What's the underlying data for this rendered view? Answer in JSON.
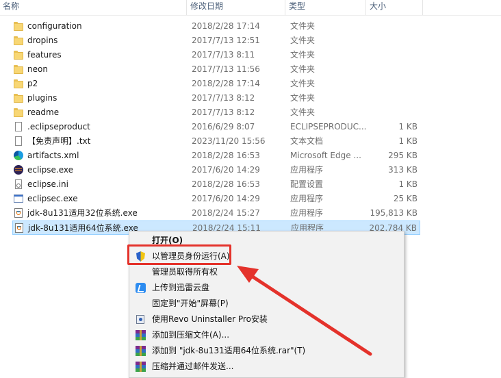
{
  "columns": {
    "name": "名称",
    "date": "修改日期",
    "type": "类型",
    "size": "大小"
  },
  "files": [
    {
      "name": "configuration",
      "date": "2018/2/28 17:14",
      "type": "文件夹",
      "size": "",
      "icon": "folder-icon"
    },
    {
      "name": "dropins",
      "date": "2017/7/13 12:51",
      "type": "文件夹",
      "size": "",
      "icon": "folder-icon"
    },
    {
      "name": "features",
      "date": "2017/7/13 8:11",
      "type": "文件夹",
      "size": "",
      "icon": "folder-icon"
    },
    {
      "name": "neon",
      "date": "2017/7/13 11:56",
      "type": "文件夹",
      "size": "",
      "icon": "folder-icon"
    },
    {
      "name": "p2",
      "date": "2018/2/28 17:14",
      "type": "文件夹",
      "size": "",
      "icon": "folder-icon"
    },
    {
      "name": "plugins",
      "date": "2017/7/13 8:12",
      "type": "文件夹",
      "size": "",
      "icon": "folder-icon"
    },
    {
      "name": "readme",
      "date": "2017/7/13 8:12",
      "type": "文件夹",
      "size": "",
      "icon": "folder-icon"
    },
    {
      "name": ".eclipseproduct",
      "date": "2016/6/29 8:07",
      "type": "ECLIPSEPRODUC...",
      "size": "1 KB",
      "icon": "document-icon"
    },
    {
      "name": "【免责声明】.txt",
      "date": "2023/11/20 15:56",
      "type": "文本文档",
      "size": "1 KB",
      "icon": "text-file-icon"
    },
    {
      "name": "artifacts.xml",
      "date": "2018/2/28 16:53",
      "type": "Microsoft Edge ...",
      "size": "295 KB",
      "icon": "edge-icon"
    },
    {
      "name": "eclipse.exe",
      "date": "2017/6/20 14:29",
      "type": "应用程序",
      "size": "313 KB",
      "icon": "eclipse-icon"
    },
    {
      "name": "eclipse.ini",
      "date": "2018/2/28 16:53",
      "type": "配置设置",
      "size": "1 KB",
      "icon": "settings-file-icon"
    },
    {
      "name": "eclipsec.exe",
      "date": "2017/6/20 14:29",
      "type": "应用程序",
      "size": "25 KB",
      "icon": "exe-icon"
    },
    {
      "name": "jdk-8u131适用32位系统.exe",
      "date": "2018/2/24 15:27",
      "type": "应用程序",
      "size": "195,813 KB",
      "icon": "java-icon"
    },
    {
      "name": "jdk-8u131适用64位系统.exe",
      "date": "2018/2/24 15:11",
      "type": "应用程序",
      "size": "202,784 KB",
      "icon": "java-icon"
    }
  ],
  "context_menu": [
    {
      "label": "打开(O)",
      "bold": true,
      "icon": ""
    },
    {
      "label": "以管理员身份运行(A)",
      "bold": false,
      "icon": "uac-shield-icon"
    },
    {
      "label": "管理员取得所有权",
      "bold": false,
      "icon": ""
    },
    {
      "label": "上传到迅雷云盘",
      "bold": false,
      "icon": "xunlei-icon"
    },
    {
      "label": "固定到\"开始\"屏幕(P)",
      "bold": false,
      "icon": ""
    },
    {
      "label": "使用Revo Uninstaller Pro安装",
      "bold": false,
      "icon": "revo-uninstaller-icon"
    },
    {
      "label": "添加到压缩文件(A)...",
      "bold": false,
      "icon": "winrar-icon"
    },
    {
      "label": "添加到 \"jdk-8u131适用64位系统.rar\"(T)",
      "bold": false,
      "icon": "winrar-icon"
    },
    {
      "label": "压缩并通过邮件发送...",
      "bold": false,
      "icon": "winrar-icon"
    }
  ],
  "colors": {
    "highlight": "#e4322b",
    "selection": "#cce8ff",
    "header_text": "#4c607a"
  }
}
